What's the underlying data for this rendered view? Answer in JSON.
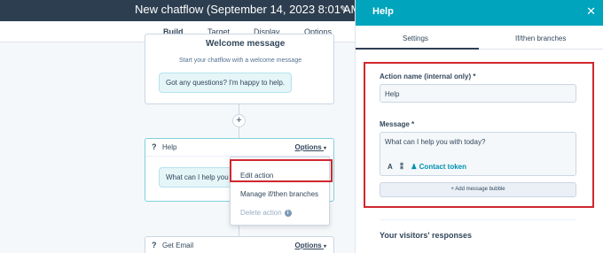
{
  "header": {
    "title": "New chatflow (September 14, 2023 8:01 AM)"
  },
  "tabs": [
    {
      "label": "Build",
      "active": true
    },
    {
      "label": "Target",
      "active": false
    },
    {
      "label": "Display",
      "active": false
    },
    {
      "label": "Options",
      "active": false
    }
  ],
  "canvas": {
    "welcome": {
      "title": "Welcome message",
      "subtitle": "Start your chatflow with a welcome message",
      "bubble": "Got any questions? I'm happy to help."
    },
    "plus_label": "+",
    "help_card": {
      "icon": "?",
      "title": "Help",
      "options_label": "Options",
      "bubble": "What can I help you"
    },
    "dropdown": {
      "items": [
        {
          "label": "Edit action",
          "disabled": false
        },
        {
          "label": "Manage if/then branches",
          "disabled": false
        },
        {
          "label": "Delete action",
          "disabled": true
        }
      ]
    },
    "email_card": {
      "icon": "?",
      "title": "Get Email",
      "options_label": "Options"
    }
  },
  "panel": {
    "title": "Help",
    "close_label": "✕",
    "tabs": [
      {
        "label": "Settings",
        "active": true
      },
      {
        "label": "If/then branches",
        "active": false
      }
    ],
    "action_name_label": "Action name (internal only) *",
    "action_name_value": "Help",
    "message_label": "Message *",
    "message_value": "What can I help you with today?",
    "toolbar": {
      "text_icon": "A",
      "var_icon": "⁑",
      "token_label": "Contact token"
    },
    "add_bubble_label": "+ Add message bubble",
    "responses_title": "Your visitors' responses"
  },
  "colors": {
    "topbar": "#2d3e50",
    "panel_header": "#00a4bd",
    "highlight": "#d0272e",
    "link": "#0091ae"
  }
}
